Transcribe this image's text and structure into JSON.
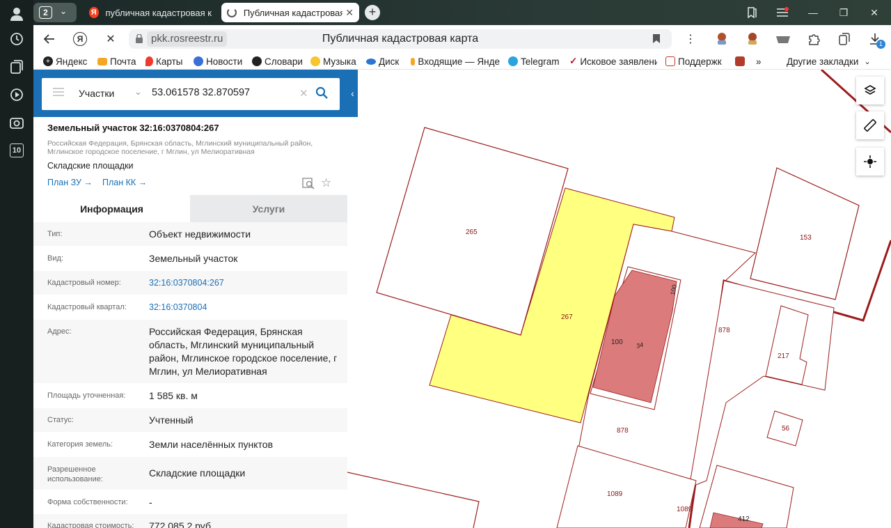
{
  "browser": {
    "tab_count_badge": "2",
    "tabs": [
      {
        "label": "публичная кадастровая к"
      },
      {
        "label": "Публичная кадастровая"
      }
    ],
    "url": "pkk.rosreestr.ru",
    "page_title": "Публичная кадастровая карта",
    "download_badge": "1",
    "side_badge": "10",
    "bookmarks": [
      {
        "label": "Яндекс"
      },
      {
        "label": "Почта"
      },
      {
        "label": "Карты"
      },
      {
        "label": "Новости"
      },
      {
        "label": "Словари"
      },
      {
        "label": "Музыка"
      },
      {
        "label": "Диск"
      },
      {
        "label": "Входящие — Янде"
      },
      {
        "label": "Telegram"
      },
      {
        "label": "Исковое заявлени"
      },
      {
        "label": "Поддержк"
      }
    ],
    "bookmarks_more": "»",
    "other_bookmarks": "Другие закладки"
  },
  "search": {
    "category": "Участки",
    "query": "53.061578 32.870597"
  },
  "card": {
    "title": "Земельный участок 32:16:0370804:267",
    "address_line": "Российская Федерация, Брянская область, Мглинский муниципальный район, Мглинское городское поселение, г Мглин, ул Мелиоративная",
    "usage": "Складские площадки",
    "link_plan_zu": "План ЗУ →",
    "link_plan_kk": "План КК →"
  },
  "info_tabs": {
    "info": "Информация",
    "services": "Услуги"
  },
  "info_rows": [
    {
      "key": "Тип:",
      "value": "Объект недвижимости"
    },
    {
      "key": "Вид:",
      "value": "Земельный участок"
    },
    {
      "key": "Кадастровый номер:",
      "value": "32:16:0370804:267"
    },
    {
      "key": "Кадастровый квартал:",
      "value": "32:16:0370804"
    },
    {
      "key": "Адрес:",
      "value": "Российская Федерация, Брянская область, Мглинский муниципальный район, Мглинское городское поселение, г Мглин, ул Мелиоративная"
    },
    {
      "key": "Площадь уточненная:",
      "value": "1 585 кв. м"
    },
    {
      "key": "Статус:",
      "value": "Учтенный"
    },
    {
      "key": "Категория земель:",
      "value": "Земли населённых пунктов"
    },
    {
      "key": "Разрешенное использование:",
      "value": "Складские площадки"
    },
    {
      "key": "Форма собственности:",
      "value": "-"
    },
    {
      "key": "Кадастровая стоимость:",
      "value": "772 085,2 руб."
    }
  ],
  "map_labels": {
    "p265": "265",
    "p267": "267",
    "p153": "153",
    "p878a": "878",
    "p878b": "878",
    "p217": "217",
    "p56": "56",
    "p1089a": "1089",
    "p1089b": "1089",
    "p412": "412",
    "b100a": "100",
    "b100b": "100",
    "b34": "34"
  },
  "colors": {
    "accent": "#1a6fb5",
    "parcel_border": "#9b1c1c",
    "selected_fill": "#ffff7f",
    "building_fill": "#dc7b7b"
  }
}
